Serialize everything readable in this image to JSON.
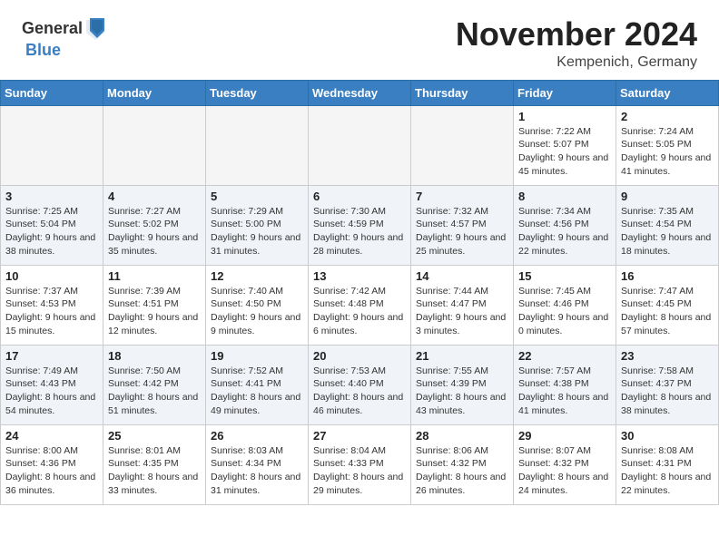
{
  "header": {
    "logo_general": "General",
    "logo_blue": "Blue",
    "month_title": "November 2024",
    "location": "Kempenich, Germany"
  },
  "weekdays": [
    "Sunday",
    "Monday",
    "Tuesday",
    "Wednesday",
    "Thursday",
    "Friday",
    "Saturday"
  ],
  "weeks": [
    [
      {
        "day": "",
        "info": ""
      },
      {
        "day": "",
        "info": ""
      },
      {
        "day": "",
        "info": ""
      },
      {
        "day": "",
        "info": ""
      },
      {
        "day": "",
        "info": ""
      },
      {
        "day": "1",
        "info": "Sunrise: 7:22 AM\nSunset: 5:07 PM\nDaylight: 9 hours and 45 minutes."
      },
      {
        "day": "2",
        "info": "Sunrise: 7:24 AM\nSunset: 5:05 PM\nDaylight: 9 hours and 41 minutes."
      }
    ],
    [
      {
        "day": "3",
        "info": "Sunrise: 7:25 AM\nSunset: 5:04 PM\nDaylight: 9 hours and 38 minutes."
      },
      {
        "day": "4",
        "info": "Sunrise: 7:27 AM\nSunset: 5:02 PM\nDaylight: 9 hours and 35 minutes."
      },
      {
        "day": "5",
        "info": "Sunrise: 7:29 AM\nSunset: 5:00 PM\nDaylight: 9 hours and 31 minutes."
      },
      {
        "day": "6",
        "info": "Sunrise: 7:30 AM\nSunset: 4:59 PM\nDaylight: 9 hours and 28 minutes."
      },
      {
        "day": "7",
        "info": "Sunrise: 7:32 AM\nSunset: 4:57 PM\nDaylight: 9 hours and 25 minutes."
      },
      {
        "day": "8",
        "info": "Sunrise: 7:34 AM\nSunset: 4:56 PM\nDaylight: 9 hours and 22 minutes."
      },
      {
        "day": "9",
        "info": "Sunrise: 7:35 AM\nSunset: 4:54 PM\nDaylight: 9 hours and 18 minutes."
      }
    ],
    [
      {
        "day": "10",
        "info": "Sunrise: 7:37 AM\nSunset: 4:53 PM\nDaylight: 9 hours and 15 minutes."
      },
      {
        "day": "11",
        "info": "Sunrise: 7:39 AM\nSunset: 4:51 PM\nDaylight: 9 hours and 12 minutes."
      },
      {
        "day": "12",
        "info": "Sunrise: 7:40 AM\nSunset: 4:50 PM\nDaylight: 9 hours and 9 minutes."
      },
      {
        "day": "13",
        "info": "Sunrise: 7:42 AM\nSunset: 4:48 PM\nDaylight: 9 hours and 6 minutes."
      },
      {
        "day": "14",
        "info": "Sunrise: 7:44 AM\nSunset: 4:47 PM\nDaylight: 9 hours and 3 minutes."
      },
      {
        "day": "15",
        "info": "Sunrise: 7:45 AM\nSunset: 4:46 PM\nDaylight: 9 hours and 0 minutes."
      },
      {
        "day": "16",
        "info": "Sunrise: 7:47 AM\nSunset: 4:45 PM\nDaylight: 8 hours and 57 minutes."
      }
    ],
    [
      {
        "day": "17",
        "info": "Sunrise: 7:49 AM\nSunset: 4:43 PM\nDaylight: 8 hours and 54 minutes."
      },
      {
        "day": "18",
        "info": "Sunrise: 7:50 AM\nSunset: 4:42 PM\nDaylight: 8 hours and 51 minutes."
      },
      {
        "day": "19",
        "info": "Sunrise: 7:52 AM\nSunset: 4:41 PM\nDaylight: 8 hours and 49 minutes."
      },
      {
        "day": "20",
        "info": "Sunrise: 7:53 AM\nSunset: 4:40 PM\nDaylight: 8 hours and 46 minutes."
      },
      {
        "day": "21",
        "info": "Sunrise: 7:55 AM\nSunset: 4:39 PM\nDaylight: 8 hours and 43 minutes."
      },
      {
        "day": "22",
        "info": "Sunrise: 7:57 AM\nSunset: 4:38 PM\nDaylight: 8 hours and 41 minutes."
      },
      {
        "day": "23",
        "info": "Sunrise: 7:58 AM\nSunset: 4:37 PM\nDaylight: 8 hours and 38 minutes."
      }
    ],
    [
      {
        "day": "24",
        "info": "Sunrise: 8:00 AM\nSunset: 4:36 PM\nDaylight: 8 hours and 36 minutes."
      },
      {
        "day": "25",
        "info": "Sunrise: 8:01 AM\nSunset: 4:35 PM\nDaylight: 8 hours and 33 minutes."
      },
      {
        "day": "26",
        "info": "Sunrise: 8:03 AM\nSunset: 4:34 PM\nDaylight: 8 hours and 31 minutes."
      },
      {
        "day": "27",
        "info": "Sunrise: 8:04 AM\nSunset: 4:33 PM\nDaylight: 8 hours and 29 minutes."
      },
      {
        "day": "28",
        "info": "Sunrise: 8:06 AM\nSunset: 4:32 PM\nDaylight: 8 hours and 26 minutes."
      },
      {
        "day": "29",
        "info": "Sunrise: 8:07 AM\nSunset: 4:32 PM\nDaylight: 8 hours and 24 minutes."
      },
      {
        "day": "30",
        "info": "Sunrise: 8:08 AM\nSunset: 4:31 PM\nDaylight: 8 hours and 22 minutes."
      }
    ]
  ]
}
